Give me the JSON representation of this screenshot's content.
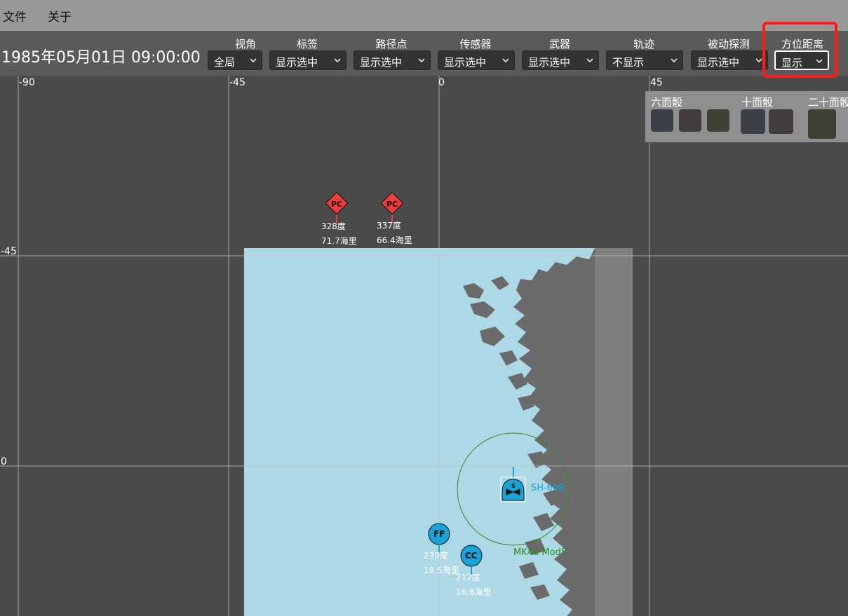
{
  "menu": {
    "file": "文件",
    "about": "关于"
  },
  "sim_time": "1985年05月01日 09:00:00",
  "filters": [
    {
      "label": "视角",
      "value": "全局"
    },
    {
      "label": "标签",
      "value": "显示选中"
    },
    {
      "label": "路径点",
      "value": "显示选中"
    },
    {
      "label": "传感器",
      "value": "显示选中"
    },
    {
      "label": "武器",
      "value": "显示选中"
    },
    {
      "label": "轨迹",
      "value": "不显示"
    },
    {
      "label": "被动探测",
      "value": "显示选中"
    },
    {
      "label": "方位距离",
      "value": "显示"
    }
  ],
  "grid": {
    "x_labels": [
      "-90",
      "-45",
      "0",
      "45"
    ],
    "y_labels": [
      "-45",
      "0"
    ]
  },
  "dice": {
    "d6": {
      "title": "六面骰",
      "colors": [
        "#3c3f48",
        "#433c3c",
        "#3d4234"
      ]
    },
    "d10": {
      "title": "十面骰",
      "colors": [
        "#3c3f48",
        "#433c3c"
      ]
    },
    "d20": {
      "title": "二十面骰",
      "colors": [
        "#3d4234"
      ]
    }
  },
  "units": {
    "pc1": {
      "symbol": "PC",
      "bearing": "328度",
      "range": "71.7海里"
    },
    "pc2": {
      "symbol": "PC",
      "bearing": "337度",
      "range": "66.4海里"
    },
    "ff": {
      "symbol": "FF",
      "bearing": "239度",
      "range": "18.5海里"
    },
    "cc": {
      "symbol": "CC",
      "bearing": "212度",
      "range": "16.8海里"
    },
    "sub": {
      "symbol": "S",
      "name": "SH-60B"
    },
    "weapon_range_label": "MK46 Mod5"
  },
  "colors": {
    "hostile": "#f03c3c",
    "friendly": "#1aa3d6",
    "friendly_text": "#1aa3d6",
    "weapon_ring": "#2e8b1e",
    "sea": "#add8e6",
    "land": "#6b6b6b",
    "land_strip": "#7f7f7f",
    "highlight": "#ff1a1a"
  }
}
